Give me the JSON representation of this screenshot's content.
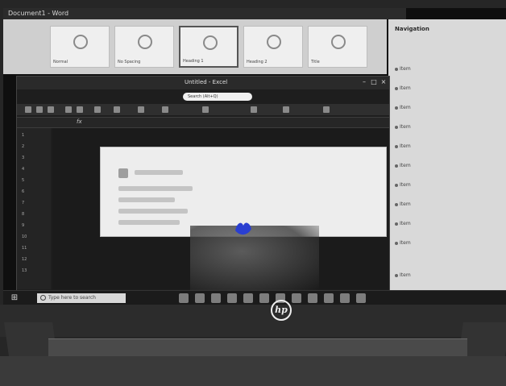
{
  "word": {
    "title": "Document1 - Word",
    "styles": [
      {
        "label": "Normal",
        "selected": false
      },
      {
        "label": "No Spacing",
        "selected": false
      },
      {
        "label": "Heading 1",
        "selected": true
      },
      {
        "label": "Heading 2",
        "selected": false
      },
      {
        "label": "Title",
        "selected": false
      }
    ]
  },
  "side_pane": {
    "title": "Navigation",
    "items": [
      "Item",
      "Item",
      "Item",
      "Item",
      "Item",
      "Item",
      "Item",
      "Item",
      "Item",
      "Item",
      "Item"
    ]
  },
  "main_window": {
    "title": "Untitled - Excel",
    "search_placeholder": "Search (Alt+Q)",
    "formula_symbol": "fx",
    "rows": [
      "1",
      "2",
      "3",
      "4",
      "5",
      "6",
      "7",
      "8",
      "9",
      "10",
      "11",
      "12",
      "13"
    ]
  },
  "taskbar": {
    "start_glyph": "⊞",
    "search_placeholder": "Type here to search"
  },
  "brand": {
    "logo_text": "hp"
  },
  "colors": {
    "pen_mark": "#2a3fd1"
  }
}
